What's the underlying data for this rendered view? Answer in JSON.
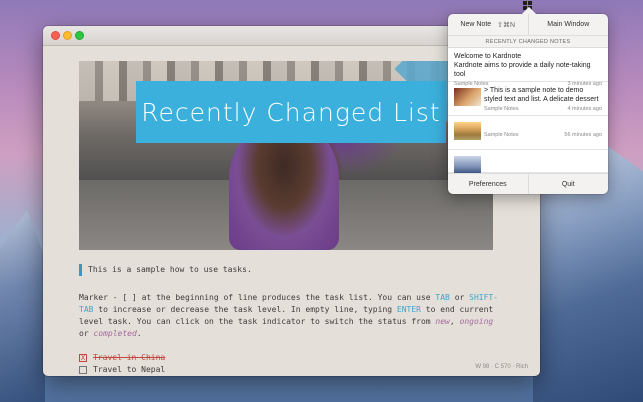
{
  "window": {
    "banner_text": "Recently Changed List",
    "content": {
      "intro": "This is a sample how to use tasks.",
      "para_parts": [
        "Marker - [ ] at the beginning of line produces the task list. You can use ",
        "TAB",
        " or ",
        "SHIFT-TAB",
        " to increase or decrease the task level. In empty line, typing ",
        "ENTER",
        " to end current level task. You can click on the task indicator to switch the status from ",
        "new",
        ", ",
        "ongoing",
        " or ",
        "completed",
        "."
      ],
      "tasks": [
        {
          "mark": "X",
          "label": "Travel in China",
          "done": true
        },
        {
          "mark": "",
          "label": "Travel to Nepal",
          "done": false
        }
      ]
    },
    "status": "W 98 · C 570 · Rich"
  },
  "popover": {
    "new_note_label": "New Note",
    "new_note_shortcut": "⇧⌘N",
    "main_window_label": "Main Window",
    "section_title": "RECENTLY CHANGED NOTES",
    "notes": [
      {
        "title": "Welcome to Kardnote\nKardnote aims to provide a daily note-taking tool",
        "notebook": "Sample Notes",
        "time": "3 minutes ago"
      },
      {
        "title": "> This is a sample note to demo styled text and list. A delicate dessert",
        "notebook": "Sample Notes",
        "time": "4 minutes ago"
      },
      {
        "title": "",
        "notebook": "Sample Notes",
        "time": "56 minutes ago"
      },
      {
        "title": "",
        "notebook": "",
        "time": ""
      }
    ],
    "preferences_label": "Preferences",
    "quit_label": "Quit"
  }
}
